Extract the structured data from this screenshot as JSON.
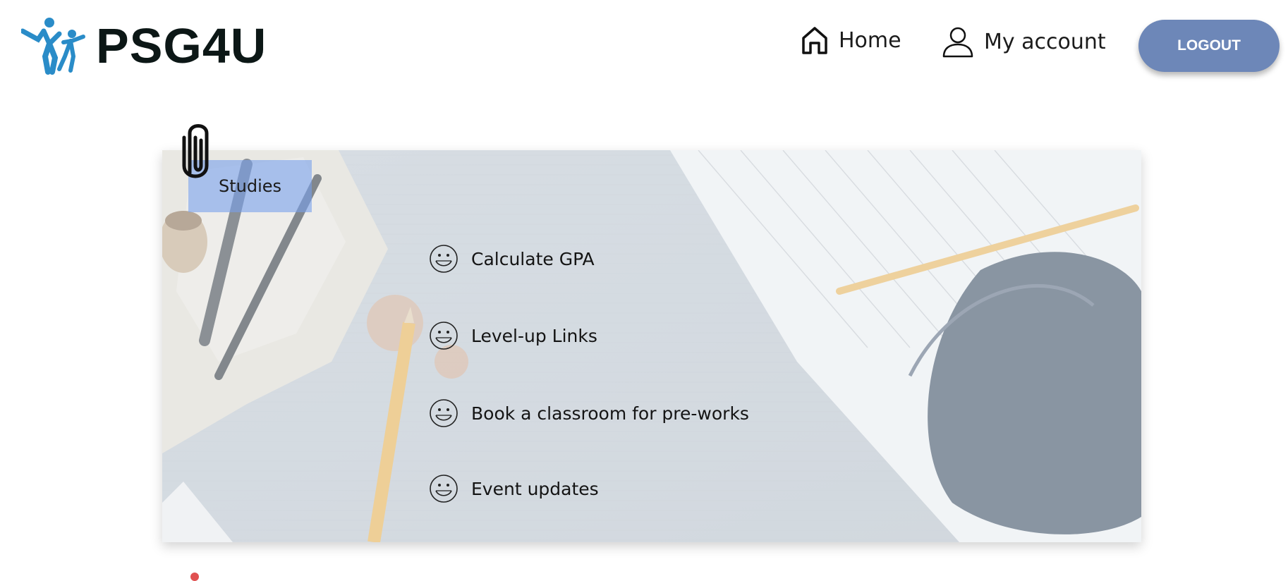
{
  "header": {
    "brand": "PSG4U",
    "nav": {
      "home_label": "Home",
      "home_icon": "home-icon",
      "account_label": "My account",
      "account_icon": "user-icon"
    },
    "logout_label": "LOGOUT"
  },
  "section": {
    "tag_label": "Studies",
    "items": [
      {
        "label": "Calculate GPA",
        "icon": "smiley-icon"
      },
      {
        "label": "Level-up Links",
        "icon": "smiley-icon"
      },
      {
        "label": "Book a classroom for pre-works",
        "icon": "smiley-icon"
      },
      {
        "label": "Event updates",
        "icon": "smiley-icon"
      }
    ]
  },
  "colors": {
    "logout_bg": "#6d87b8",
    "tag_bg": "#78a0eb",
    "brand_text": "#0c1716",
    "logo_blue": "#2a8cc8"
  }
}
